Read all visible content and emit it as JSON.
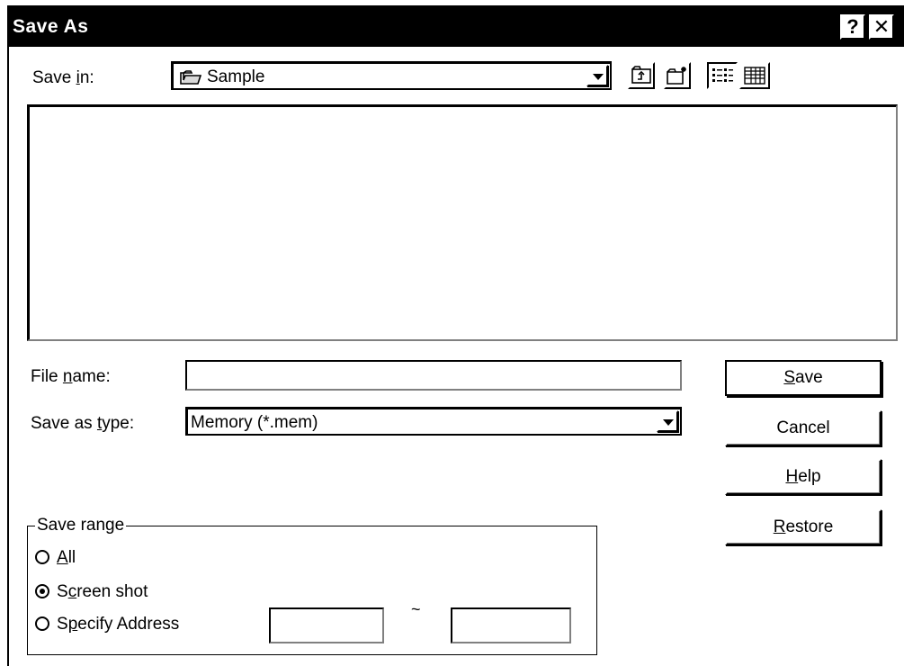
{
  "window": {
    "title": "Save As",
    "help_glyph": "?",
    "close_glyph": "✕"
  },
  "save_in": {
    "label_pre": "Save ",
    "label_ul": "i",
    "label_post": "n:",
    "value": "Sample",
    "icons": [
      "folder-icon",
      "up-one-level-icon",
      "new-folder-icon",
      "list-view-icon",
      "details-view-icon"
    ]
  },
  "file_name": {
    "label_pre": "File ",
    "label_ul": "n",
    "label_post": "ame:",
    "value": ""
  },
  "save_as_type": {
    "label_pre": "Save as ",
    "label_ul": "t",
    "label_post": "ype:",
    "value": "Memory (*.mem)"
  },
  "buttons": {
    "save": {
      "ul": "S",
      "rest": "ave"
    },
    "cancel": "Cancel",
    "help": {
      "ul": "H",
      "rest": "elp"
    },
    "restore": {
      "ul": "R",
      "rest": "estore"
    }
  },
  "save_range": {
    "title": "Save range",
    "options": [
      {
        "pre": "",
        "ul": "A",
        "post": "ll",
        "selected": false
      },
      {
        "pre": "S",
        "ul": "c",
        "post": "reen shot",
        "selected": true
      },
      {
        "pre": "S",
        "ul": "p",
        "post": "ecify Address",
        "selected": false
      }
    ],
    "range_separator": "~",
    "start_address": "",
    "end_address": ""
  }
}
